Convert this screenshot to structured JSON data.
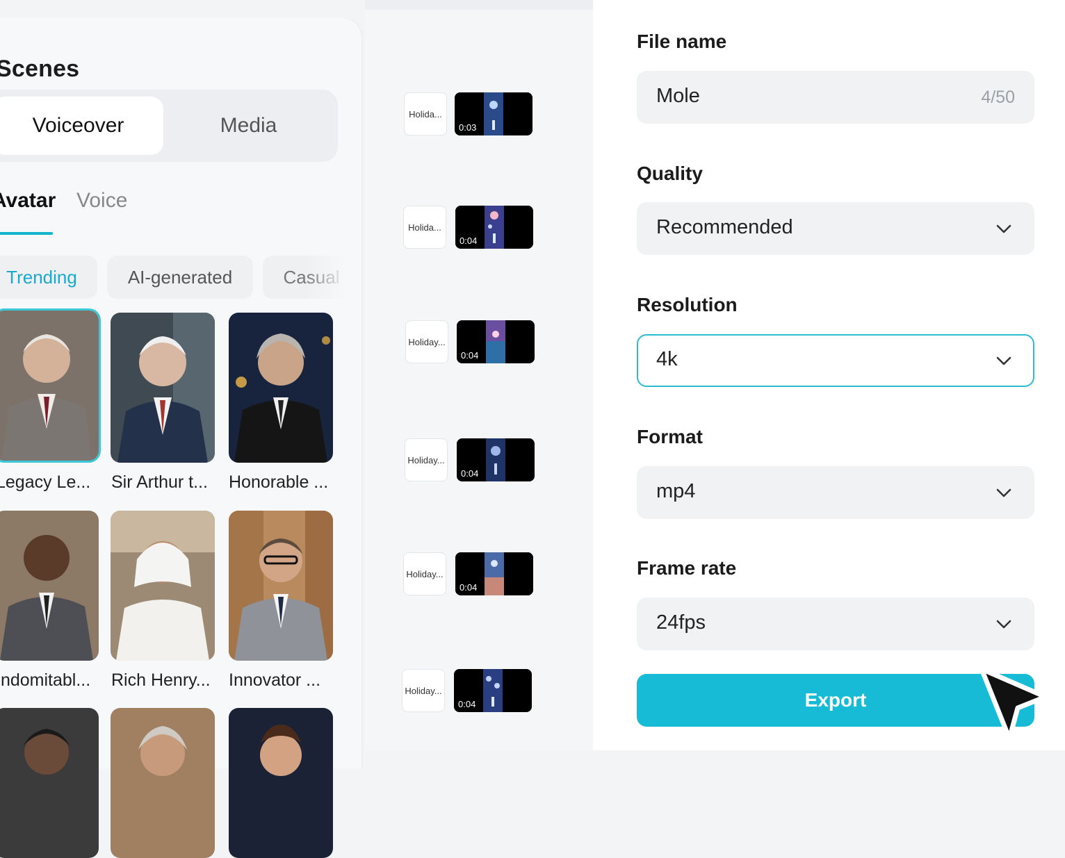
{
  "scenes_panel": {
    "title": "Scenes",
    "segments": {
      "voiceover": "Voiceover",
      "media": "Media"
    },
    "subtabs": {
      "avatar": "Avatar",
      "voice": "Voice"
    },
    "chips": [
      "Trending",
      "AI-generated",
      "Casual"
    ],
    "avatars": [
      {
        "name": "Legacy Le..."
      },
      {
        "name": "Sir Arthur t..."
      },
      {
        "name": "Honorable ..."
      },
      {
        "name": "Indomitabl..."
      },
      {
        "name": "Rich Henry..."
      },
      {
        "name": "Innovator ..."
      }
    ]
  },
  "scene_strip": {
    "items": [
      {
        "label": "Holida...",
        "duration": "0:03"
      },
      {
        "label": "Holida...",
        "duration": "0:04"
      },
      {
        "label": "Holiday...",
        "duration": "0:04"
      },
      {
        "label": "Holiday...",
        "duration": "0:04"
      },
      {
        "label": "Holiday...",
        "duration": "0:04"
      },
      {
        "label": "Holiday...",
        "duration": "0:04"
      }
    ]
  },
  "export_panel": {
    "file_name": {
      "label": "File name",
      "value": "Mole",
      "count": "4/50"
    },
    "quality": {
      "label": "Quality",
      "value": "Recommended"
    },
    "resolution": {
      "label": "Resolution",
      "value": "4k"
    },
    "format": {
      "label": "Format",
      "value": "mp4"
    },
    "frame_rate": {
      "label": "Frame rate",
      "value": "24fps"
    },
    "export_label": "Export"
  },
  "colors": {
    "accent": "#17bbd6",
    "focus_border": "#2bbcd4"
  }
}
